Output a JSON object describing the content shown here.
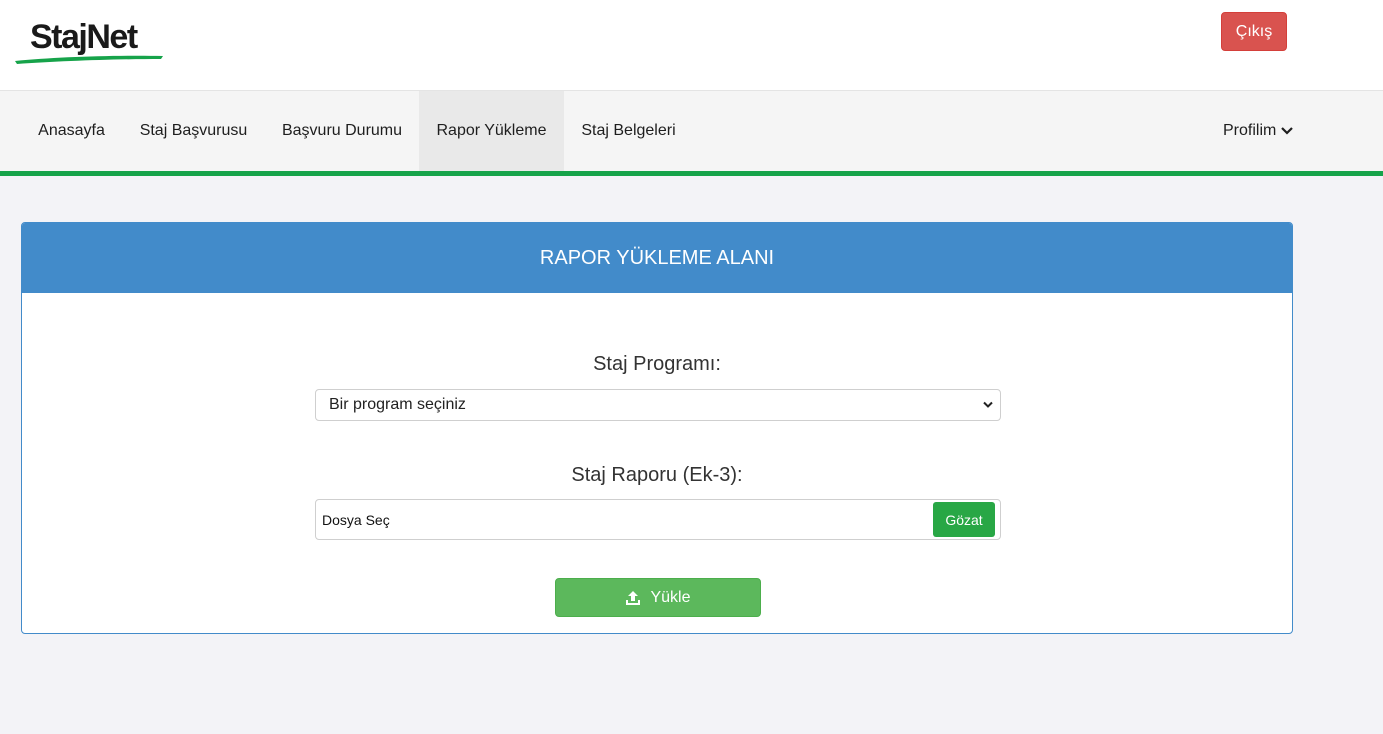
{
  "header": {
    "logo_text": "StajNet",
    "logout_label": "Çıkış"
  },
  "nav": {
    "items": [
      {
        "label": "Anasayfa"
      },
      {
        "label": "Staj Başvurusu"
      },
      {
        "label": "Başvuru Durumu"
      },
      {
        "label": "Rapor Yükleme"
      },
      {
        "label": "Staj Belgeleri"
      }
    ],
    "active": "Rapor Yükleme",
    "profile_label": "Profilim"
  },
  "panel": {
    "title": "RAPOR YÜKLEME ALANI",
    "program_label": "Staj Programı:",
    "program_selected": "Bir program seçiniz",
    "report_label": "Staj Raporu (Ek-3):",
    "file_placeholder": "Dosya Seç",
    "browse_label": "Gözat",
    "upload_label": "Yükle"
  },
  "colors": {
    "brand_green": "#16a34a",
    "panel_blue": "#428bca",
    "logout_red": "#d9534f",
    "upload_green": "#5cb85c",
    "browse_green": "#28a745"
  }
}
